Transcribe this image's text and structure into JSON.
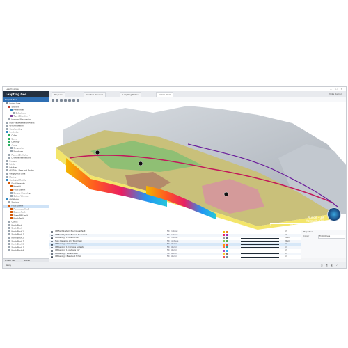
{
  "window": {
    "title": "Leapfrog Geo",
    "controls": "—  ☐  ✕"
  },
  "app": {
    "logo": "Leapfrog Geo",
    "user": "Mike Ramer"
  },
  "tabs": [
    {
      "label": "Projects"
    },
    {
      "label": "Central Browser"
    },
    {
      "label": "Leapfrog Notes"
    },
    {
      "label": "Scene View"
    }
  ],
  "project_tree": {
    "header": "Project Tree",
    "items": [
      {
        "label": "Project Data",
        "color": "#7f8b97",
        "indent": 1
      },
      {
        "label": "Sections",
        "color": "#c0392b",
        "indent": 2
      },
      {
        "label": "Preferences",
        "color": "#2e86c1",
        "indent": 3
      },
      {
        "label": "Collections",
        "color": "#9aa4ae",
        "indent": 4
      },
      {
        "label": "Topo / Elevation 7",
        "color": "#7d3c98",
        "indent": 3
      },
      {
        "label": "Imported Boundaries",
        "color": "#9aa4ae",
        "indent": 2
      },
      {
        "label": "Multi-Data Reference Points",
        "color": "#9aa4ae",
        "indent": 1
      },
      {
        "label": "Grid/Annotation",
        "color": "#9aa4ae",
        "indent": 1
      },
      {
        "label": "Geochemistry",
        "color": "#9aa4ae",
        "indent": 1
      },
      {
        "label": "Boreholes",
        "color": "#2e86c1",
        "indent": 1
      },
      {
        "label": "Collar",
        "color": "#27ae60",
        "indent": 2
      },
      {
        "label": "Survey",
        "color": "#27ae60",
        "indent": 2
      },
      {
        "label": "Lithology",
        "color": "#27ae60",
        "indent": 2
      },
      {
        "label": "Assay",
        "color": "#27ae60",
        "indent": 2
      },
      {
        "label": "Composites",
        "color": "#9aa4ae",
        "indent": 3
      },
      {
        "label": "Structures",
        "color": "#9aa4ae",
        "indent": 3
      },
      {
        "label": "Planned Drillholes",
        "color": "#9aa4ae",
        "indent": 2
      },
      {
        "label": "Drillhole Intersections",
        "color": "#9aa4ae",
        "indent": 2
      },
      {
        "label": "Designs",
        "color": "#9aa4ae",
        "indent": 1
      },
      {
        "label": "Points",
        "color": "#9aa4ae",
        "indent": 1
      },
      {
        "label": "Polylines",
        "color": "#9aa4ae",
        "indent": 1
      },
      {
        "label": "GIS Data, Maps and Photos",
        "color": "#9aa4ae",
        "indent": 1
      },
      {
        "label": "Geophysical Data",
        "color": "#9aa4ae",
        "indent": 1
      },
      {
        "label": "Meshes",
        "color": "#9aa4ae",
        "indent": 1
      },
      {
        "label": "Geological Models",
        "color": "#2e86c1",
        "indent": 1
      },
      {
        "label": "Fault Networks",
        "color": "#d35400",
        "indent": 2
      },
      {
        "label": "Model A",
        "color": "#d35400",
        "indent": 3
      },
      {
        "label": "Fault System",
        "color": "#d35400",
        "indent": 3
      },
      {
        "label": "Surface Chronology",
        "color": "#9aa4ae",
        "indent": 3
      },
      {
        "label": "Output Volumes",
        "color": "#9aa4ae",
        "indent": 3
      },
      {
        "label": "GM Models",
        "color": "#2e86c1",
        "indent": 1
      },
      {
        "label": "Sections",
        "color": "#9aa4ae",
        "indent": 2
      },
      {
        "label": "Fault System",
        "color": "#d35400",
        "indent": 2,
        "selected": true
      },
      {
        "label": "Pre-mineral Fault",
        "color": "#d35400",
        "indent": 3
      },
      {
        "label": "Eastern Fault",
        "color": "#d35400",
        "indent": 3
      },
      {
        "label": "Shear 888 Fault",
        "color": "#d35400",
        "indent": 3
      },
      {
        "label": "North Fault",
        "color": "#d35400",
        "indent": 3
      },
      {
        "label": "Output",
        "color": "#9aa4ae",
        "indent": 2
      },
      {
        "label": "North Block",
        "color": "#9aa4ae",
        "indent": 2
      },
      {
        "label": "South Block",
        "color": "#9aa4ae",
        "indent": 2
      },
      {
        "label": "North Block 1",
        "color": "#9aa4ae",
        "indent": 2
      },
      {
        "label": "South Block 1",
        "color": "#9aa4ae",
        "indent": 2
      },
      {
        "label": "North Block 2",
        "color": "#9aa4ae",
        "indent": 2
      },
      {
        "label": "South Block 2",
        "color": "#9aa4ae",
        "indent": 2
      },
      {
        "label": "North Block 3",
        "color": "#9aa4ae",
        "indent": 2
      },
      {
        "label": "South Block 3",
        "color": "#9aa4ae",
        "indent": 2
      },
      {
        "label": "North Block 4",
        "color": "#9aa4ae",
        "indent": 2
      }
    ]
  },
  "scene": {
    "plunge": "Plunge +39",
    "azimuth": "Azimuth 334",
    "scale_labels": [
      "0",
      "500",
      "1000",
      "1500"
    ]
  },
  "layers": [
    {
      "name": "GM Fault System: Pre-mineral fault",
      "type": "Fill: Footwall",
      "c1": "#f4b400",
      "c2": "#e67e22",
      "value": "0.5"
    },
    {
      "name": "GM Fault System: Eastern fault mesh",
      "type": "Fill: Footwall",
      "c1": "#e91e63",
      "c2": "#9c27b0",
      "value": "0.5"
    },
    {
      "name": "GM Geology 1: Overburden",
      "type": "Fill: Footwall",
      "c1": "#9e9e9e",
      "c2": "#5d6d7e",
      "value": "Filled"
    },
    {
      "name": "Topo: Elevation grid Topo mesh",
      "type": "Fill: Contours",
      "c1": "#8bc34a",
      "c2": "#4caf50",
      "value": "Filled"
    },
    {
      "name": "GM Geology: Granodiorite",
      "type": "Fill: Interior",
      "c1": "#ff9800",
      "c2": "#f44336",
      "value": "0.9"
    },
    {
      "name": "GM Geology 1: Intrusive Andesite",
      "type": "Fill: Interior",
      "c1": "#ff7043",
      "c2": "#26a69a",
      "value": "0.9"
    },
    {
      "name": "GM Geology 1: Andesite Tuff",
      "type": "Fill: Interior",
      "c1": "#ab47bc",
      "c2": "#29b6f6",
      "value": "0.5"
    },
    {
      "name": "GM Geology: Volcanic Sed",
      "type": "Fill: Interior",
      "c1": "#ffca28",
      "c2": "#8d6e63",
      "value": "0.9"
    },
    {
      "name": "GM Geology: Basement Schist",
      "type": "Fill: Interior",
      "c1": "#ef5350",
      "c2": "#78909c",
      "value": "0.9"
    }
  ],
  "properties": {
    "header": "Properties",
    "row_label": "Colour",
    "row_value": "From Values"
  },
  "bottom_tabs": [
    "Project Tree",
    "Shared"
  ],
  "status": {
    "left": "Ready",
    "right": "◫ ◩ ◧ ✓"
  }
}
